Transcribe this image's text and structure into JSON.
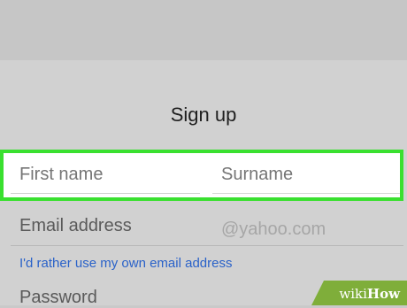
{
  "form": {
    "title": "Sign up",
    "first_name_placeholder": "First name",
    "surname_placeholder": "Surname",
    "email_label": "Email address",
    "email_suffix": "@yahoo.com",
    "own_email_link": "I'd rather use my own email address",
    "password_label": "Password"
  },
  "highlight_color": "#39e02f",
  "watermark": {
    "prefix": "wiki",
    "suffix": "How"
  }
}
